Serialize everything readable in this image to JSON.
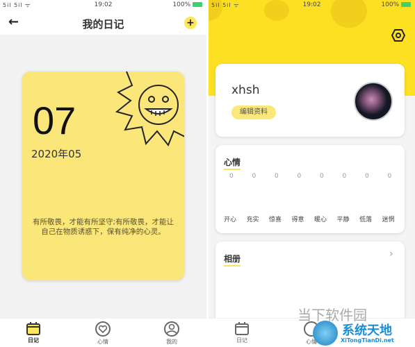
{
  "status": {
    "time": "19:02",
    "battery": "100%",
    "signal": "5il 5il ᯤ"
  },
  "left": {
    "title": "我的日记",
    "diary": {
      "day": "07",
      "year_month": "2020年05",
      "text": "有所敬畏，才能有所坚守;有所敬畏，才能让自己在物质诱惑下，保有纯净的心灵。"
    }
  },
  "right": {
    "username": "xhsh",
    "edit_profile": "编辑资料",
    "mood": {
      "title": "心情",
      "items": [
        {
          "label": "开心",
          "count": "0"
        },
        {
          "label": "充实",
          "count": "0"
        },
        {
          "label": "惊喜",
          "count": "0"
        },
        {
          "label": "得意",
          "count": "0"
        },
        {
          "label": "暖心",
          "count": "0"
        },
        {
          "label": "平静",
          "count": "0"
        },
        {
          "label": "低落",
          "count": "0"
        },
        {
          "label": "迷惘",
          "count": "0"
        }
      ]
    },
    "album": {
      "title": "相册"
    }
  },
  "nav": {
    "items": [
      {
        "label": "日记",
        "icon": "calendar-icon"
      },
      {
        "label": "心情",
        "icon": "heart-icon"
      },
      {
        "label": "我的",
        "icon": "user-icon"
      }
    ]
  },
  "watermark": {
    "text1": "当下软件园",
    "text2": "系统天地",
    "text3": "XiTongTianDi.net"
  },
  "colors": {
    "accent": "#fde021",
    "card": "#fbe67a"
  }
}
